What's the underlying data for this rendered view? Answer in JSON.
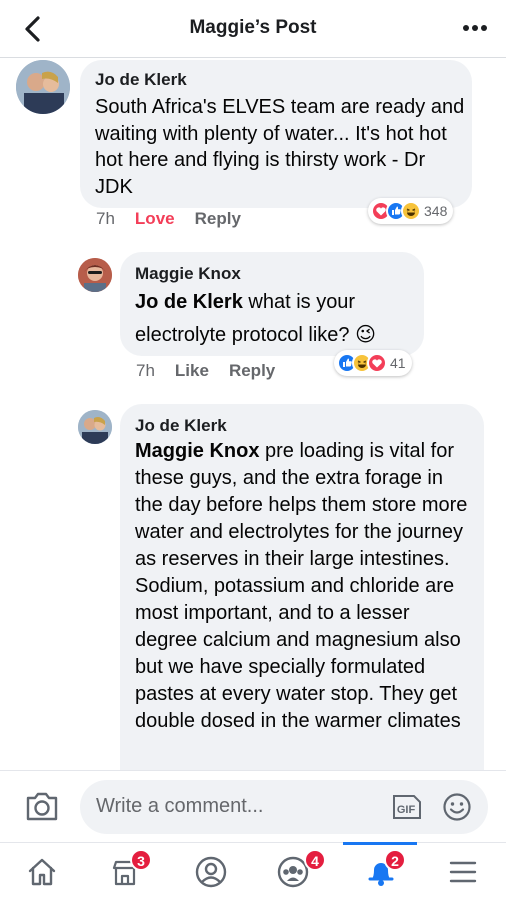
{
  "header": {
    "title": "Maggie’s Post",
    "back_icon": "chevron-left-icon",
    "more_icon": "more-horizontal-icon"
  },
  "comments": [
    {
      "author": "Jo de Klerk",
      "text": "South Africa's ELVES team are ready and waiting with plenty of water... It's hot hot hot here and flying is thirsty work - Dr JDK",
      "time": "7h",
      "reaction_label": "Love",
      "reply_label": "Reply",
      "reactions": [
        "love",
        "like",
        "haha"
      ],
      "reaction_count": "348"
    },
    {
      "author": "Maggie Knox",
      "mention": "Jo de Klerk",
      "text": " what is your electrolyte protocol like? 😉",
      "time": "7h",
      "like_label": "Like",
      "reply_label": "Reply",
      "reactions": [
        "like",
        "haha",
        "love"
      ],
      "reaction_count": "41"
    },
    {
      "author": "Jo de Klerk",
      "mention": "Maggie Knox",
      "text": " pre loading is vital for these guys, and the extra forage in the day before helps them store more water and electrolytes for the journey as reserves in their large intestines. Sodium, potassium and chloride are most important, and to a lesser degree calcium and magnesium also but we have specially formulated pastes at every water stop. They get double dosed in the warmer climates"
    }
  ],
  "composer": {
    "placeholder": "Write a comment...",
    "gif_label": "GIF"
  },
  "tabbar": {
    "items": [
      {
        "name": "home",
        "badge": ""
      },
      {
        "name": "marketplace",
        "badge": "3"
      },
      {
        "name": "profile",
        "badge": ""
      },
      {
        "name": "groups",
        "badge": "4"
      },
      {
        "name": "notifications",
        "badge": "2"
      },
      {
        "name": "menu",
        "badge": ""
      }
    ]
  },
  "colors": {
    "accent": "#1877f2",
    "love": "#f33e58",
    "badge": "#e41e3f",
    "bubble": "#f0f2f5"
  }
}
